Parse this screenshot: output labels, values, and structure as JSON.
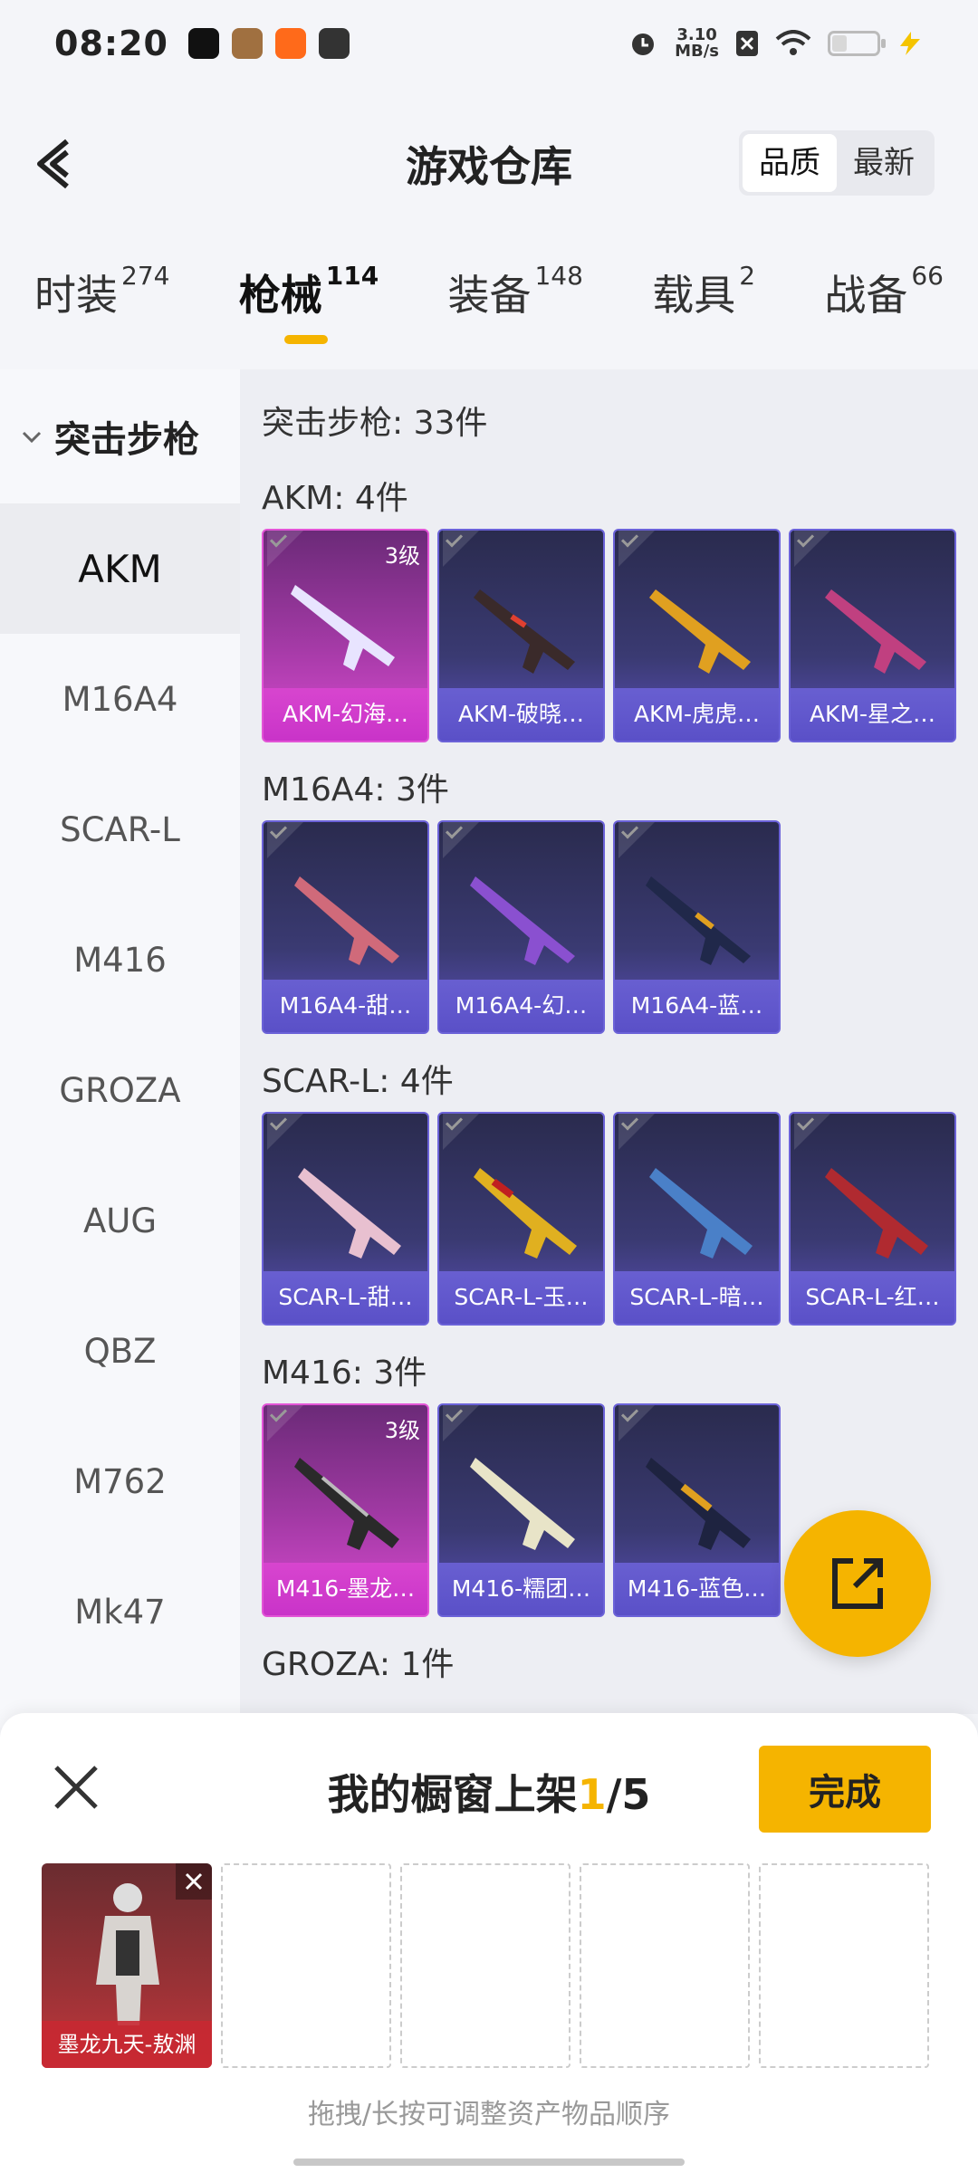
{
  "status_bar": {
    "time": "08:20",
    "speed_value": "3.10",
    "speed_unit": "MB/s"
  },
  "header": {
    "title": "游戏仓库",
    "sort_options": [
      "品质",
      "最新"
    ]
  },
  "tabs": [
    {
      "label": "时装",
      "count": "274"
    },
    {
      "label": "枪械",
      "count": "114"
    },
    {
      "label": "装备",
      "count": "148"
    },
    {
      "label": "载具",
      "count": "2"
    },
    {
      "label": "战备",
      "count": "66"
    }
  ],
  "sidebar": {
    "group": "突击步枪",
    "items": [
      "AKM",
      "M16A4",
      "SCAR-L",
      "M416",
      "GROZA",
      "AUG",
      "QBZ",
      "M762",
      "Mk47"
    ]
  },
  "content": {
    "total": "突击步枪: 33件",
    "groups": [
      {
        "title": "AKM: 4件",
        "items": [
          {
            "name": "AKM-幻海…",
            "level": "3级"
          },
          {
            "name": "AKM-破晓…"
          },
          {
            "name": "AKM-虎虎…"
          },
          {
            "name": "AKM-星之…"
          }
        ]
      },
      {
        "title": "M16A4: 3件",
        "items": [
          {
            "name": "M16A4-甜…"
          },
          {
            "name": "M16A4-幻…"
          },
          {
            "name": "M16A4-蓝…"
          }
        ]
      },
      {
        "title": "SCAR-L: 4件",
        "items": [
          {
            "name": "SCAR-L-甜…"
          },
          {
            "name": "SCAR-L-玉…"
          },
          {
            "name": "SCAR-L-暗…"
          },
          {
            "name": "SCAR-L-红…"
          }
        ]
      },
      {
        "title": "M416: 3件",
        "items": [
          {
            "name": "M416-墨龙…",
            "level": "3级"
          },
          {
            "name": "M416-糯团…"
          },
          {
            "name": "M416-蓝色…"
          }
        ]
      },
      {
        "title": "GROZA: 1件"
      }
    ]
  },
  "sheet": {
    "title_prefix": "我的橱窗上架",
    "current": "1",
    "total": "/5",
    "done_label": "完成",
    "filled_item": "墨龙九天-敖渊",
    "hint": "拖拽/长按可调整资产物品顺序"
  },
  "colors": {
    "accent": "#f5b400",
    "card_purple": "#3a3a72",
    "card_legend": "#a43aa6"
  }
}
